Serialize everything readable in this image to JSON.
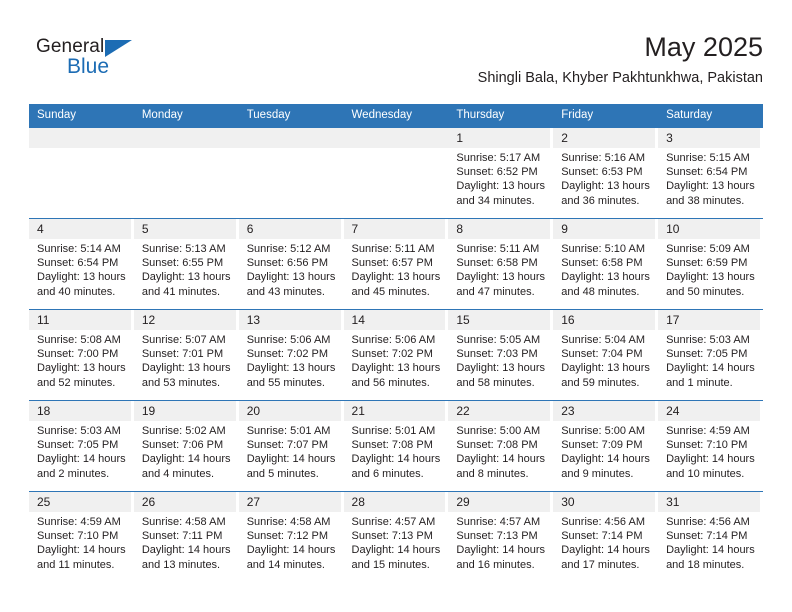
{
  "brand": {
    "name_part1": "General",
    "name_part2": "Blue",
    "flag_color": "#1c6cb4",
    "logo_icon": "triangle-flag-icon"
  },
  "header": {
    "title": "May 2025",
    "subtitle": "Shingli Bala, Khyber Pakhtunkhwa, Pakistan"
  },
  "theme": {
    "header_blue": "#2e75b6",
    "row_divider_blue": "#2e75b6",
    "daynum_band": "#f0f0f0",
    "text": "#231f20"
  },
  "calendar": {
    "weekday_headers": [
      "Sunday",
      "Monday",
      "Tuesday",
      "Wednesday",
      "Thursday",
      "Friday",
      "Saturday"
    ],
    "weeks": [
      [
        {
          "day": "",
          "sunrise": "",
          "sunset": "",
          "daylight_line1": "",
          "daylight_line2": ""
        },
        {
          "day": "",
          "sunrise": "",
          "sunset": "",
          "daylight_line1": "",
          "daylight_line2": ""
        },
        {
          "day": "",
          "sunrise": "",
          "sunset": "",
          "daylight_line1": "",
          "daylight_line2": ""
        },
        {
          "day": "",
          "sunrise": "",
          "sunset": "",
          "daylight_line1": "",
          "daylight_line2": ""
        },
        {
          "day": "1",
          "sunrise": "Sunrise: 5:17 AM",
          "sunset": "Sunset: 6:52 PM",
          "daylight_line1": "Daylight: 13 hours",
          "daylight_line2": "and 34 minutes."
        },
        {
          "day": "2",
          "sunrise": "Sunrise: 5:16 AM",
          "sunset": "Sunset: 6:53 PM",
          "daylight_line1": "Daylight: 13 hours",
          "daylight_line2": "and 36 minutes."
        },
        {
          "day": "3",
          "sunrise": "Sunrise: 5:15 AM",
          "sunset": "Sunset: 6:54 PM",
          "daylight_line1": "Daylight: 13 hours",
          "daylight_line2": "and 38 minutes."
        }
      ],
      [
        {
          "day": "4",
          "sunrise": "Sunrise: 5:14 AM",
          "sunset": "Sunset: 6:54 PM",
          "daylight_line1": "Daylight: 13 hours",
          "daylight_line2": "and 40 minutes."
        },
        {
          "day": "5",
          "sunrise": "Sunrise: 5:13 AM",
          "sunset": "Sunset: 6:55 PM",
          "daylight_line1": "Daylight: 13 hours",
          "daylight_line2": "and 41 minutes."
        },
        {
          "day": "6",
          "sunrise": "Sunrise: 5:12 AM",
          "sunset": "Sunset: 6:56 PM",
          "daylight_line1": "Daylight: 13 hours",
          "daylight_line2": "and 43 minutes."
        },
        {
          "day": "7",
          "sunrise": "Sunrise: 5:11 AM",
          "sunset": "Sunset: 6:57 PM",
          "daylight_line1": "Daylight: 13 hours",
          "daylight_line2": "and 45 minutes."
        },
        {
          "day": "8",
          "sunrise": "Sunrise: 5:11 AM",
          "sunset": "Sunset: 6:58 PM",
          "daylight_line1": "Daylight: 13 hours",
          "daylight_line2": "and 47 minutes."
        },
        {
          "day": "9",
          "sunrise": "Sunrise: 5:10 AM",
          "sunset": "Sunset: 6:58 PM",
          "daylight_line1": "Daylight: 13 hours",
          "daylight_line2": "and 48 minutes."
        },
        {
          "day": "10",
          "sunrise": "Sunrise: 5:09 AM",
          "sunset": "Sunset: 6:59 PM",
          "daylight_line1": "Daylight: 13 hours",
          "daylight_line2": "and 50 minutes."
        }
      ],
      [
        {
          "day": "11",
          "sunrise": "Sunrise: 5:08 AM",
          "sunset": "Sunset: 7:00 PM",
          "daylight_line1": "Daylight: 13 hours",
          "daylight_line2": "and 52 minutes."
        },
        {
          "day": "12",
          "sunrise": "Sunrise: 5:07 AM",
          "sunset": "Sunset: 7:01 PM",
          "daylight_line1": "Daylight: 13 hours",
          "daylight_line2": "and 53 minutes."
        },
        {
          "day": "13",
          "sunrise": "Sunrise: 5:06 AM",
          "sunset": "Sunset: 7:02 PM",
          "daylight_line1": "Daylight: 13 hours",
          "daylight_line2": "and 55 minutes."
        },
        {
          "day": "14",
          "sunrise": "Sunrise: 5:06 AM",
          "sunset": "Sunset: 7:02 PM",
          "daylight_line1": "Daylight: 13 hours",
          "daylight_line2": "and 56 minutes."
        },
        {
          "day": "15",
          "sunrise": "Sunrise: 5:05 AM",
          "sunset": "Sunset: 7:03 PM",
          "daylight_line1": "Daylight: 13 hours",
          "daylight_line2": "and 58 minutes."
        },
        {
          "day": "16",
          "sunrise": "Sunrise: 5:04 AM",
          "sunset": "Sunset: 7:04 PM",
          "daylight_line1": "Daylight: 13 hours",
          "daylight_line2": "and 59 minutes."
        },
        {
          "day": "17",
          "sunrise": "Sunrise: 5:03 AM",
          "sunset": "Sunset: 7:05 PM",
          "daylight_line1": "Daylight: 14 hours",
          "daylight_line2": "and 1 minute."
        }
      ],
      [
        {
          "day": "18",
          "sunrise": "Sunrise: 5:03 AM",
          "sunset": "Sunset: 7:05 PM",
          "daylight_line1": "Daylight: 14 hours",
          "daylight_line2": "and 2 minutes."
        },
        {
          "day": "19",
          "sunrise": "Sunrise: 5:02 AM",
          "sunset": "Sunset: 7:06 PM",
          "daylight_line1": "Daylight: 14 hours",
          "daylight_line2": "and 4 minutes."
        },
        {
          "day": "20",
          "sunrise": "Sunrise: 5:01 AM",
          "sunset": "Sunset: 7:07 PM",
          "daylight_line1": "Daylight: 14 hours",
          "daylight_line2": "and 5 minutes."
        },
        {
          "day": "21",
          "sunrise": "Sunrise: 5:01 AM",
          "sunset": "Sunset: 7:08 PM",
          "daylight_line1": "Daylight: 14 hours",
          "daylight_line2": "and 6 minutes."
        },
        {
          "day": "22",
          "sunrise": "Sunrise: 5:00 AM",
          "sunset": "Sunset: 7:08 PM",
          "daylight_line1": "Daylight: 14 hours",
          "daylight_line2": "and 8 minutes."
        },
        {
          "day": "23",
          "sunrise": "Sunrise: 5:00 AM",
          "sunset": "Sunset: 7:09 PM",
          "daylight_line1": "Daylight: 14 hours",
          "daylight_line2": "and 9 minutes."
        },
        {
          "day": "24",
          "sunrise": "Sunrise: 4:59 AM",
          "sunset": "Sunset: 7:10 PM",
          "daylight_line1": "Daylight: 14 hours",
          "daylight_line2": "and 10 minutes."
        }
      ],
      [
        {
          "day": "25",
          "sunrise": "Sunrise: 4:59 AM",
          "sunset": "Sunset: 7:10 PM",
          "daylight_line1": "Daylight: 14 hours",
          "daylight_line2": "and 11 minutes."
        },
        {
          "day": "26",
          "sunrise": "Sunrise: 4:58 AM",
          "sunset": "Sunset: 7:11 PM",
          "daylight_line1": "Daylight: 14 hours",
          "daylight_line2": "and 13 minutes."
        },
        {
          "day": "27",
          "sunrise": "Sunrise: 4:58 AM",
          "sunset": "Sunset: 7:12 PM",
          "daylight_line1": "Daylight: 14 hours",
          "daylight_line2": "and 14 minutes."
        },
        {
          "day": "28",
          "sunrise": "Sunrise: 4:57 AM",
          "sunset": "Sunset: 7:13 PM",
          "daylight_line1": "Daylight: 14 hours",
          "daylight_line2": "and 15 minutes."
        },
        {
          "day": "29",
          "sunrise": "Sunrise: 4:57 AM",
          "sunset": "Sunset: 7:13 PM",
          "daylight_line1": "Daylight: 14 hours",
          "daylight_line2": "and 16 minutes."
        },
        {
          "day": "30",
          "sunrise": "Sunrise: 4:56 AM",
          "sunset": "Sunset: 7:14 PM",
          "daylight_line1": "Daylight: 14 hours",
          "daylight_line2": "and 17 minutes."
        },
        {
          "day": "31",
          "sunrise": "Sunrise: 4:56 AM",
          "sunset": "Sunset: 7:14 PM",
          "daylight_line1": "Daylight: 14 hours",
          "daylight_line2": "and 18 minutes."
        }
      ]
    ]
  }
}
